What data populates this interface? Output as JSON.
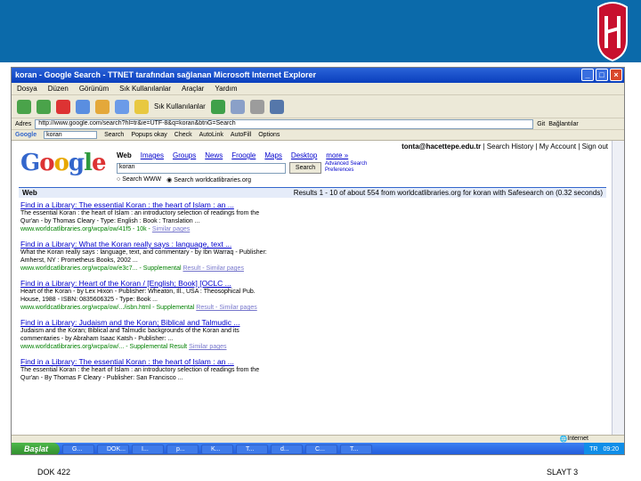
{
  "colors": {
    "header": "#0b6aaa",
    "logo": "#c8102e",
    "link": "#0000cc",
    "url": "#008000"
  },
  "window": {
    "title": "koran - Google Search - TTNET tarafından sağlanan Microsoft Internet Explorer",
    "menu": [
      "Dosya",
      "Düzen",
      "Görünüm",
      "Sık Kullanılanlar",
      "Araçlar",
      "Yardım"
    ],
    "favorites_label": "Sık Kullanılanlar",
    "address_label": "Adres",
    "address": "http://www.google.com/search?hl=tr&ie=UTF-8&q=koran&btnG=Search",
    "go_label": "Git",
    "links_label": "Bağlantılar"
  },
  "google_toolbar": {
    "label": "Google",
    "query": "koran",
    "search": "Search",
    "popups": "Popups okay",
    "check": "Check",
    "autolink": "AutoLink",
    "autofill": "AutoFill",
    "options": "Options"
  },
  "page": {
    "user": "tonta@hacettepe.edu.tr",
    "user_links": "| Search History | My Account | Sign out",
    "logo": "Google",
    "tabs": [
      "Web",
      "Images",
      "Groups",
      "News",
      "Froogle",
      "Maps",
      "Desktop",
      "more »"
    ],
    "query": "koran",
    "search_button": "Search",
    "adv_links": [
      "Advanced Search",
      "Preferences"
    ],
    "radio_www": "Search WWW",
    "radio_worldcat": "Search worldcatlibraries.org",
    "web_label": "Web",
    "results_info": "Results 1 - 10 of about 554 from worldcatlibraries.org for koran with Safesearch on (0.32 seconds)"
  },
  "results": [
    {
      "title": "Find in a Library: The essential Koran : the heart of Islam : an ...",
      "snippet": [
        "The essential Koran : the heart of Islam : an introductory selection of readings from the",
        "Qur'an - by Thomas Cleary - Type: English : Book : Translation ..."
      ],
      "url": "www.worldcatlibraries.org/wcpa/ow/41f5 - 10k -",
      "similar": "Similar pages"
    },
    {
      "title": "Find in a Library: What the Koran really says : language, text ...",
      "snippet": [
        "What the Koran really says : language, text, and commentary - by Ibn Warraq - Publisher:",
        "Amherst, NY : Prometheus Books, 2002 ..."
      ],
      "url": "www.worldcatlibraries.org/wcpa/ow/e3c7... - Supplemental",
      "similar": "Result - Similar pages"
    },
    {
      "title": "Find in a Library: Heart of the Koran / [English; Book] [OCLC ...",
      "snippet": [
        "Heart of the Koran - by Lex Hixon - Publisher: Wheaton, Ill., USA : Theosophical Pub.",
        "House, 1988 - ISBN: 0835606325 - Type: Book ..."
      ],
      "url": "www.worldcatlibraries.org/wcpa/ow/.../isbn.html - Supplemental",
      "similar": "Result - Similar pages"
    },
    {
      "title": "Find in a Library: Judaism and the Koran; Biblical and Talmudic ...",
      "snippet": [
        "Judaism and the Koran; Biblical and Talmudic backgrounds of the Koran and its",
        "commentaries - by Abraham Isaac Katsh - Publisher: ..."
      ],
      "url": "www.worldcatlibraries.org/wcpa/ow/... - Supplemental Result",
      "similar": "Similar pages"
    },
    {
      "title": "Find in a Library: The essential Koran : the heart of Islam : an ...",
      "snippet": [
        "The essential Koran : the heart of Islam : an introductory selection of readings from the",
        "Qur'an - By Thomas F Cleary - Publisher: San Francisco ..."
      ],
      "url": "",
      "similar": ""
    }
  ],
  "status": {
    "zone": "Internet"
  },
  "taskbar": {
    "start": "Başlat",
    "tasks": [
      "G...",
      "DOK...",
      "I...",
      "p...",
      "K...",
      "T...",
      "d...",
      "C...",
      "T..."
    ],
    "lang": "TR",
    "time": "09:20"
  },
  "footer": {
    "left": "DOK 422",
    "right": "SLAYT 3"
  }
}
